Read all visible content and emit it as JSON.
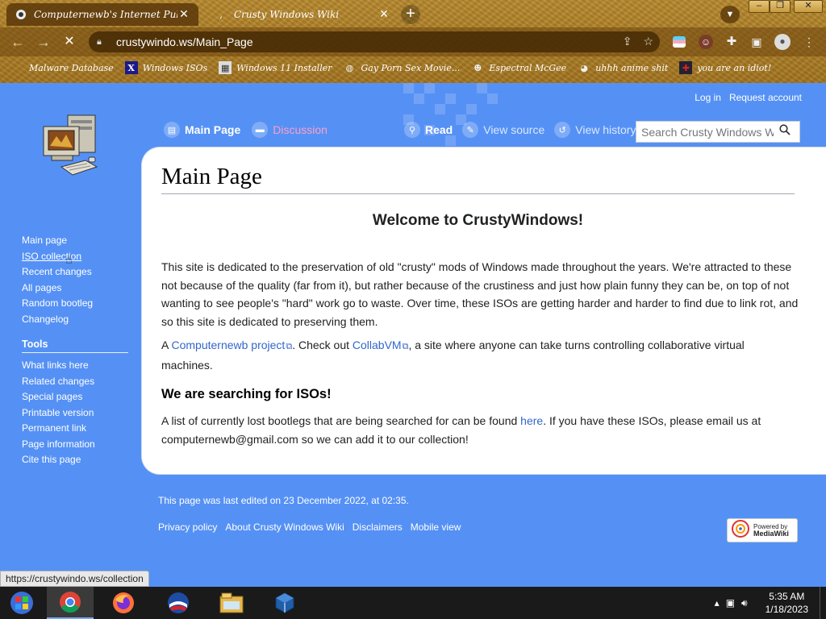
{
  "browser": {
    "tabs": [
      {
        "title": "Computernewb's Internet Pub Hu",
        "favicon": "computernewb-icon",
        "active": true
      },
      {
        "title": "Crusty Windows Wiki",
        "favicon": "wiki-icon",
        "active": false
      }
    ],
    "close_glyph": "✕",
    "new_tab_glyph": "+",
    "url": "crustywindo.ws/Main_Page",
    "window_controls": {
      "minimize": "–",
      "maximize": "❐",
      "close": "✕"
    },
    "bookmarks": [
      {
        "label": "Malware Database",
        "icon": "skull-icon"
      },
      {
        "label": "Windows ISOs",
        "icon": "x-icon"
      },
      {
        "label": "Windows 11 Installer",
        "icon": "installer-icon"
      },
      {
        "label": "Gay Porn Sex Movie...",
        "icon": "globe-icon"
      },
      {
        "label": "Espectral McGee",
        "icon": "face-icon"
      },
      {
        "label": "uhhh anime shit",
        "icon": "anime-icon"
      },
      {
        "label": "you are an idiot!",
        "icon": "flag-icon"
      }
    ],
    "status_url": "https://crustywindo.ws/collection"
  },
  "wiki": {
    "user_links": [
      "Log in",
      "Request account"
    ],
    "sidebar": {
      "navigation": [
        "Main page",
        "ISO collection",
        "Recent changes",
        "All pages",
        "Random bootleg",
        "Changelog"
      ],
      "tools_heading": "Tools",
      "tools": [
        "What links here",
        "Related changes",
        "Special pages",
        "Printable version",
        "Permanent link",
        "Page information",
        "Cite this page"
      ]
    },
    "page_tabs": {
      "main": "Main Page",
      "discussion": "Discussion"
    },
    "view_tabs": {
      "read": "Read",
      "view_source": "View source",
      "view_history": "View history"
    },
    "search_placeholder": "Search Crusty Windows Wiki",
    "title": "Main Page",
    "welcome": "Welcome to CrustyWindows!",
    "intro": "This site is dedicated to the preservation of old \"crusty\" mods of Windows made throughout the years. We're attracted to these not because of the quality (far from it), but rather because of the crustiness and just how plain funny they can be, on top of not wanting to see people's \"hard\" work go to waste. Over time, these ISOs are getting harder and harder to find due to link rot, and so this site is dedicated to preserving them.",
    "project_line": {
      "prefix": "A ",
      "link1": "Computernewb project",
      "middle": ". Check out ",
      "link2": "CollabVM",
      "suffix": ", a site where anyone can take turns controlling collaborative virtual machines."
    },
    "searching_heading": "We are searching for ISOs!",
    "searching_text": {
      "prefix": "A list of currently lost bootlegs that are being searched for can be found ",
      "link": "here",
      "suffix": ". If you have these ISOs, please email us at computernewb@gmail.com so we can add it to our collection!"
    },
    "footer": {
      "last_edited": "This page was last edited on 23 December 2022, at 02:35.",
      "links": [
        "Privacy policy",
        "About Crusty Windows Wiki",
        "Disclaimers",
        "Mobile view"
      ],
      "powered_line1": "Powered by",
      "powered_line2": "MediaWiki"
    }
  },
  "taskbar": {
    "apps": [
      "start-orb-icon",
      "chrome-icon",
      "firefox-icon",
      "obama-icon",
      "file-explorer-icon",
      "virtualbox-icon"
    ],
    "time": "5:35 AM",
    "date": "1/18/2023"
  },
  "colors": {
    "page_bg": "#5591f5",
    "link": "#3366cc",
    "discussion": "#ff9ec7"
  }
}
